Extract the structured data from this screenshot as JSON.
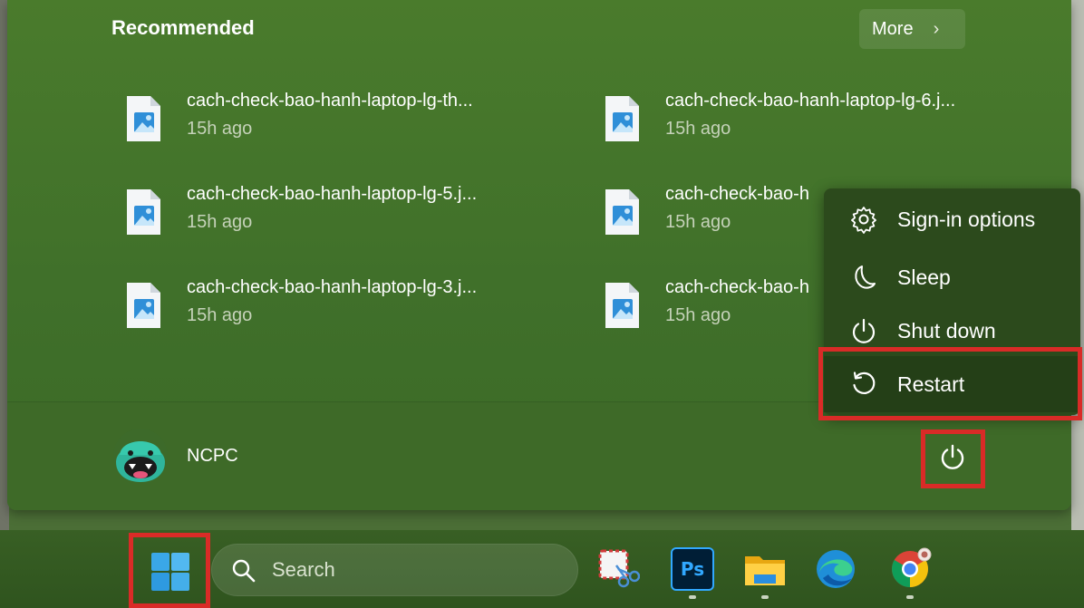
{
  "start_menu": {
    "recommended_title": "Recommended",
    "more_label": "More",
    "recommended": [
      {
        "name": "cach-check-bao-hanh-laptop-lg-th...",
        "time": "15h ago",
        "icon": "image-file-icon"
      },
      {
        "name": "cach-check-bao-hanh-laptop-lg-6.j...",
        "time": "15h ago",
        "icon": "image-file-icon"
      },
      {
        "name": "cach-check-bao-hanh-laptop-lg-5.j...",
        "time": "15h ago",
        "icon": "image-file-icon"
      },
      {
        "name": "cach-check-bao-h",
        "time": "15h ago",
        "icon": "image-file-icon"
      },
      {
        "name": "cach-check-bao-hanh-laptop-lg-3.j...",
        "time": "15h ago",
        "icon": "image-file-icon"
      },
      {
        "name": "cach-check-bao-h",
        "time": "15h ago",
        "icon": "image-file-icon"
      }
    ],
    "user": {
      "name": "NCPC",
      "icon": "avatar-icon"
    },
    "power_icon": "power-icon"
  },
  "power_menu": {
    "items": [
      {
        "label": "Sign-in options",
        "icon": "gear-icon"
      },
      {
        "label": "Sleep",
        "icon": "moon-icon"
      },
      {
        "label": "Shut down",
        "icon": "power-icon"
      },
      {
        "label": "Restart",
        "icon": "restart-icon"
      }
    ]
  },
  "taskbar": {
    "search_placeholder": "Search",
    "apps": [
      {
        "name": "snipping-tool",
        "icon": "snipping-tool-icon",
        "running": false
      },
      {
        "name": "photoshop",
        "icon": "photoshop-icon",
        "label": "Ps",
        "running": true
      },
      {
        "name": "file-explorer",
        "icon": "folder-icon",
        "running": true
      },
      {
        "name": "edge",
        "icon": "edge-icon",
        "running": false
      },
      {
        "name": "chrome",
        "icon": "chrome-icon",
        "running": true
      }
    ]
  },
  "colors": {
    "panel": "#40702a",
    "flyout": "#2c4a1c",
    "annotation": "#d92b27",
    "windows_blue": "#3aa7e8"
  }
}
